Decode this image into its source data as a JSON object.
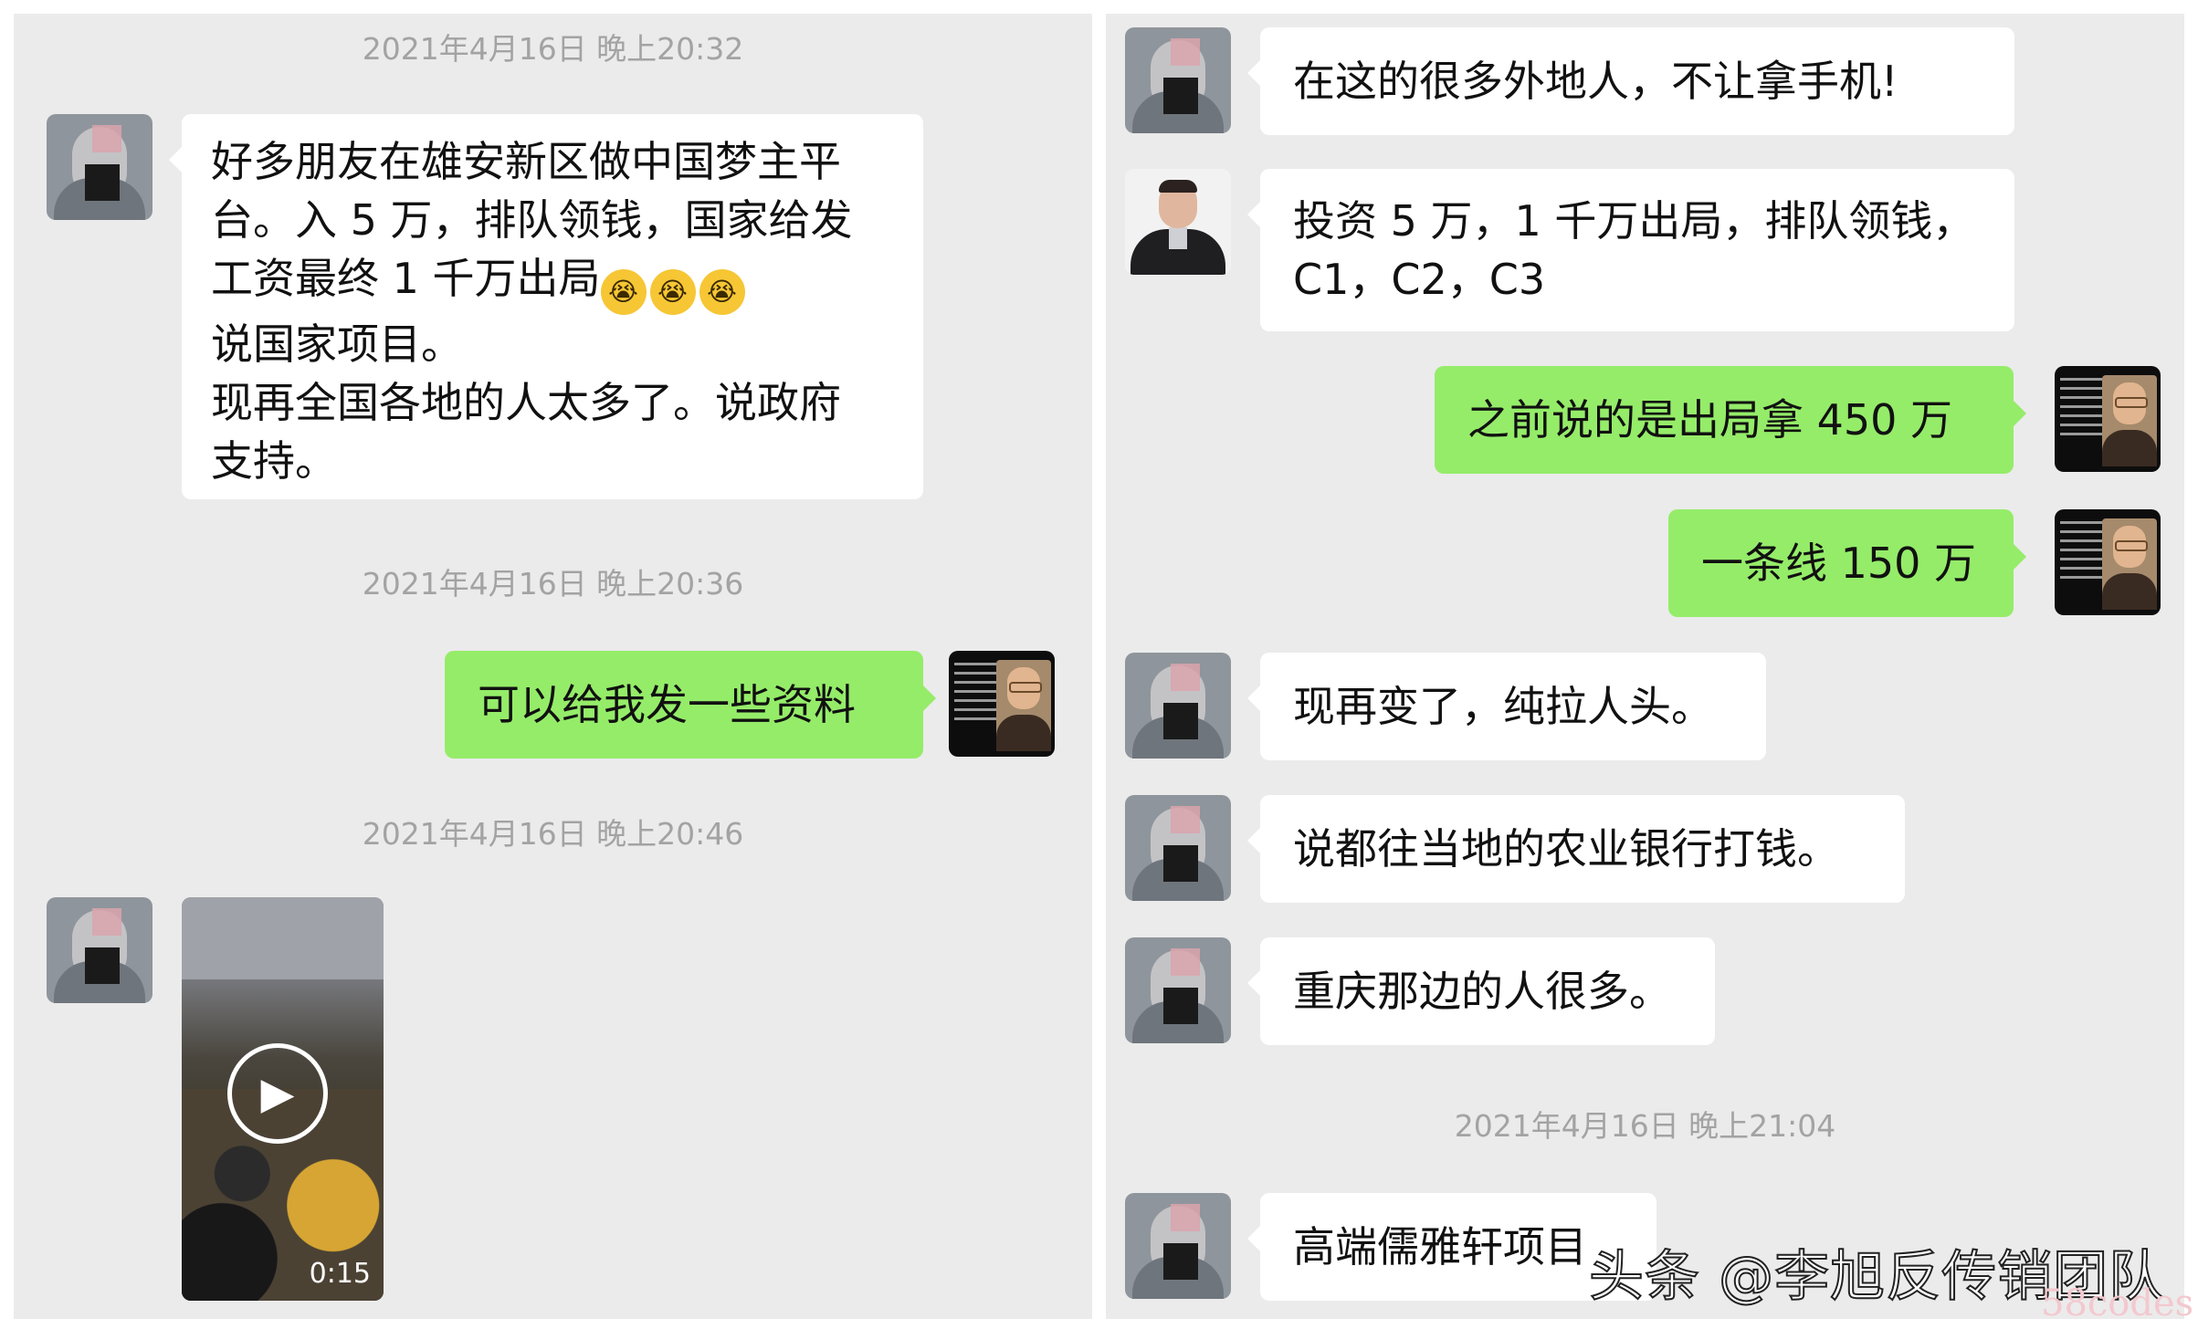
{
  "left": {
    "timestamps": [
      "2021年4月16日 晚上20:32",
      "2021年4月16日 晚上20:36",
      "2021年4月16日 晚上20:46"
    ],
    "msg1_lines": [
      "好多朋友在雄安新区做中国梦主平",
      "台。入 5 万，排队领钱，国家给发",
      "工资最终 1 千万出局",
      "说国家项目。",
      "现再全国各地的人太多了。说政府",
      "支持。"
    ],
    "emoji": [
      "😭",
      "😭",
      "😭"
    ],
    "msg2": "可以给我发一些资料",
    "video_duration": "0:15"
  },
  "right": {
    "msg1": "在这的很多外地人，不让拿手机!",
    "msg2_lines": [
      "投资 5 万，1 千万出局，排队领钱，",
      "C1，C2，C3"
    ],
    "msg3": "之前说的是出局拿 450 万",
    "msg4": "一条线 150 万",
    "msg5": "现再变了，纯拉人头。",
    "msg6": "说都往当地的农业银行打钱。",
    "msg7": "重庆那边的人很多。",
    "timestamp": "2021年4月16日 晚上21:04",
    "msg8": "高端儒雅轩项目"
  },
  "watermark": "头条 @李旭反传销团队",
  "site_watermark": "58codes",
  "colors": {
    "background": "#ebebeb",
    "sent_bubble": "#95ec69",
    "received_bubble": "#ffffff",
    "timestamp_text": "#a3a3a3"
  }
}
